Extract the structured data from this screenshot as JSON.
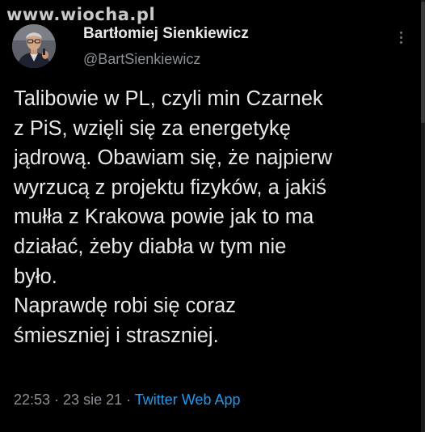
{
  "watermark": "www.wiocha.pl",
  "author": {
    "display_name": "Bartłomiej Sienkiewicz",
    "handle": "@BartSienkiewicz"
  },
  "tweet": {
    "lines": [
      "Talibowie w PL, czyli min Czarnek",
      "z PiS, wzięli się za energetykę",
      "jądrową. Obawiam się, że najpierw",
      "wyrzucą z projektu fizyków, a jakiś",
      "mułła z Krakowa powie jak to ma",
      "działać, żeby diabła w tym nie",
      "było.",
      "Naprawdę robi się coraz",
      "śmieszniej i straszniej."
    ]
  },
  "meta": {
    "time": "22:53",
    "separator1": " · ",
    "date": "23 sie 21",
    "separator2": " · ",
    "app": "Twitter Web App"
  },
  "icons": {
    "more": "more-vertical-icon"
  },
  "colors": {
    "background": "#000000",
    "text": "#e7e9ea",
    "secondary": "#8b9096",
    "link": "#1d9bf0"
  }
}
